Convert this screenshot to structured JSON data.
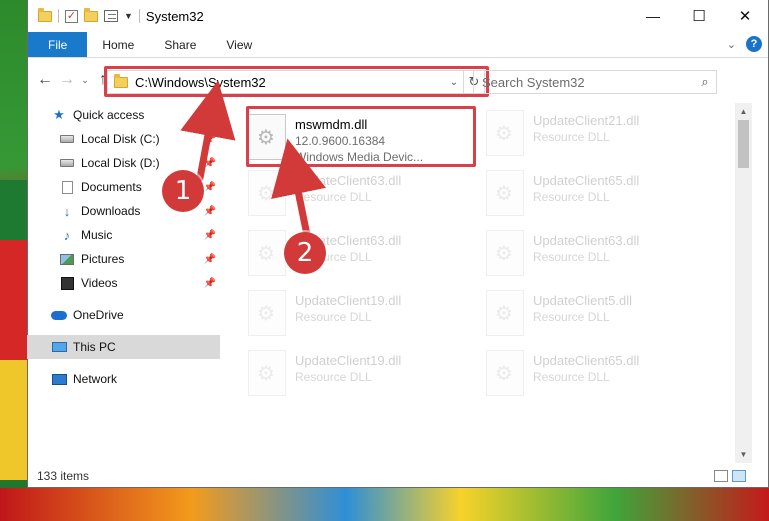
{
  "window": {
    "title": "System32",
    "controls": {
      "minimize": "—",
      "maximize": "☐",
      "close": "✕"
    }
  },
  "ribbon": {
    "tabs": [
      "File",
      "Home",
      "Share",
      "View"
    ],
    "help": "?"
  },
  "address": {
    "path": "C:\\Windows\\System32",
    "search_placeholder": "Search System32"
  },
  "nav": {
    "quick_access": "Quick access",
    "items": [
      {
        "label": "Local Disk (C:)",
        "icon": "drive-icon"
      },
      {
        "label": "Local Disk (D:)",
        "icon": "drive-icon"
      },
      {
        "label": "Documents",
        "icon": "documents-icon"
      },
      {
        "label": "Downloads",
        "icon": "downloads-icon"
      },
      {
        "label": "Music",
        "icon": "music-icon"
      },
      {
        "label": "Pictures",
        "icon": "pictures-icon"
      },
      {
        "label": "Videos",
        "icon": "videos-icon"
      }
    ],
    "onedrive": "OneDrive",
    "this_pc": "This PC",
    "network": "Network"
  },
  "files": {
    "selected": {
      "name": "mswmdm.dll",
      "version": "12.0.9600.16384",
      "description": "Windows Media Devic..."
    },
    "background": [
      {
        "name": "UpdateClient21.dll",
        "type": "Resource DLL"
      },
      {
        "name": "UpdateClient63.dll",
        "type": "Resource DLL"
      },
      {
        "name": "UpdateClient65.dll",
        "type": "Resource DLL"
      },
      {
        "name": "UpdateClient63.dll",
        "type": "Resource DLL"
      },
      {
        "name": "UpdateClient63.dll",
        "type": "Resource DLL"
      },
      {
        "name": "UpdateClient19.dll",
        "type": "Resource DLL"
      },
      {
        "name": "UpdateClient5.dll",
        "type": "Resource DLL"
      },
      {
        "name": "UpdateClient19.dll",
        "type": "Resource DLL"
      },
      {
        "name": "UpdateClient65.dll",
        "type": "Resource DLL"
      }
    ]
  },
  "status": {
    "item_count": "133 items"
  },
  "callouts": {
    "one": "1",
    "two": "2",
    "color": "#d23a3a"
  }
}
